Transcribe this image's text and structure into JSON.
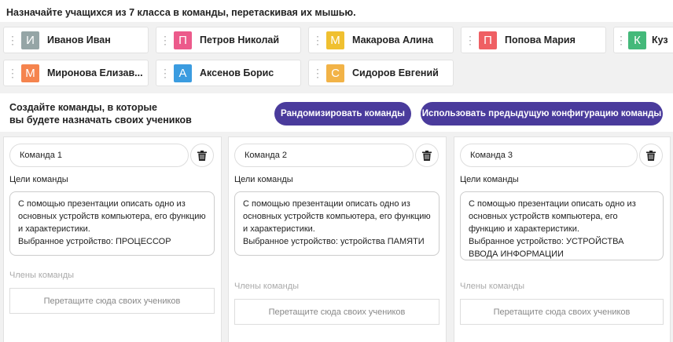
{
  "instruction": "Назначайте учащихся из 7 класса в команды, перетаскивая их мышью.",
  "students": [
    {
      "name": "Иванов Иван",
      "initial": "И",
      "color": "#95a5a6"
    },
    {
      "name": "Петров Николай",
      "initial": "П",
      "color": "#ec5a8b"
    },
    {
      "name": "Макарова Алина",
      "initial": "М",
      "color": "#f0c030"
    },
    {
      "name": "Попова Мария",
      "initial": "П",
      "color": "#ef5f63"
    },
    {
      "name": "Куз",
      "initial": "К",
      "color": "#44b97a"
    },
    {
      "name": "Миронова Елизав...",
      "initial": "М",
      "color": "#f5844e"
    },
    {
      "name": "Аксенов Борис",
      "initial": "А",
      "color": "#3b9ce0"
    },
    {
      "name": "Сидоров Евгений",
      "initial": "С",
      "color": "#f2b347"
    }
  ],
  "subtitle_line1": "Создайте команды, в которые",
  "subtitle_line2": "вы будете назначать своих учеников",
  "randomize_label": "Рандомизировать команды",
  "previous_config_label": "Использовать предыдущую конфигурацию команды",
  "teams": [
    {
      "name": "Команда 1",
      "goals_label": "Цели команды",
      "goals": "С помощью презентации описать одно из основных устройств компьютера, его функцию и характеристики.\nВыбранное устройство: ПРОЦЕССОР",
      "members_label": "Члены команды",
      "drop_hint": "Перетащите сюда своих учеников"
    },
    {
      "name": "Команда 2",
      "goals_label": "Цели команды",
      "goals": "С помощью презентации описать одно из основных устройств компьютера, его функцию и характеристики.\nВыбранное устройство: устройства ПАМЯТИ",
      "members_label": "Члены команды",
      "drop_hint": "Перетащите сюда своих учеников"
    },
    {
      "name": "Команда 3",
      "goals_label": "Цели команды",
      "goals": "С помощью презентации описать одно из основных устройств компьютера, его функцию и характеристики.\nВыбранное устройство: УСТРОЙСТВА ВВОДА ИНФОРМАЦИИ",
      "members_label": "Члены команды",
      "drop_hint": "Перетащите сюда своих учеников"
    }
  ]
}
